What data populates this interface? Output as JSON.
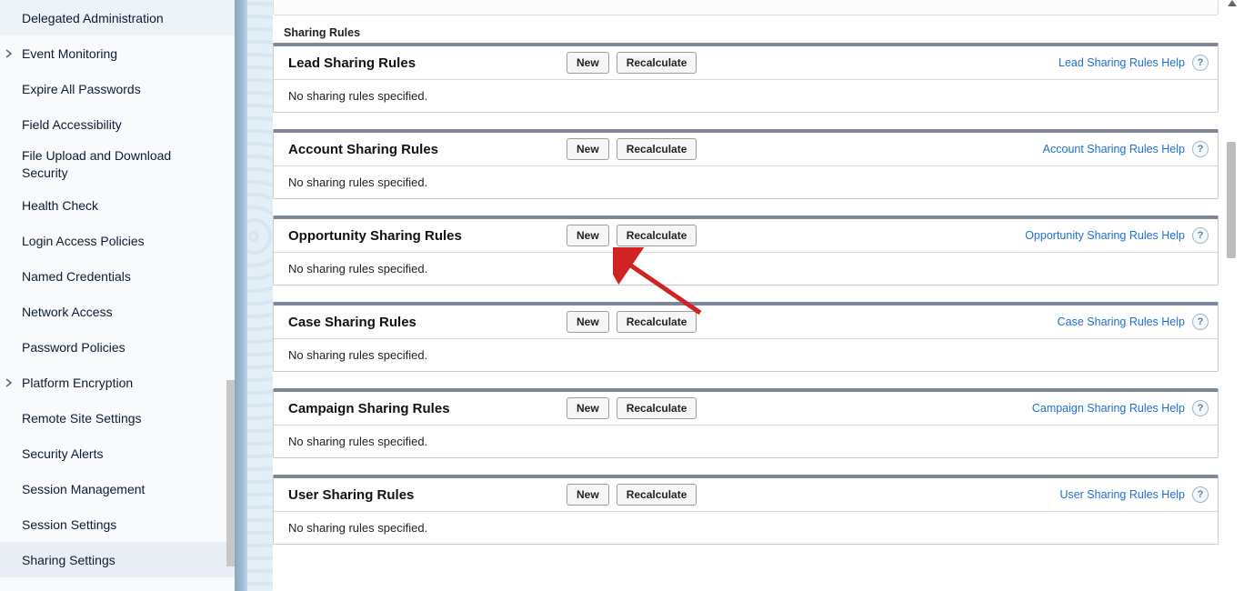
{
  "sidebar": {
    "items": [
      {
        "label": "Delegated Administration",
        "expandable": false
      },
      {
        "label": "Event Monitoring",
        "expandable": true
      },
      {
        "label": "Expire All Passwords",
        "expandable": false
      },
      {
        "label": "Field Accessibility",
        "expandable": false
      },
      {
        "label": "File Upload and Download Security",
        "expandable": false
      },
      {
        "label": "Health Check",
        "expandable": false
      },
      {
        "label": "Login Access Policies",
        "expandable": false
      },
      {
        "label": "Named Credentials",
        "expandable": false
      },
      {
        "label": "Network Access",
        "expandable": false
      },
      {
        "label": "Password Policies",
        "expandable": false
      },
      {
        "label": "Platform Encryption",
        "expandable": true
      },
      {
        "label": "Remote Site Settings",
        "expandable": false
      },
      {
        "label": "Security Alerts",
        "expandable": false
      },
      {
        "label": "Session Management",
        "expandable": false
      },
      {
        "label": "Session Settings",
        "expandable": false
      },
      {
        "label": "Sharing Settings",
        "expandable": false,
        "active": true
      }
    ]
  },
  "main": {
    "section_heading": "Sharing Rules",
    "new_label": "New",
    "recalc_label": "Recalculate",
    "empty_msg": "No sharing rules specified.",
    "blocks": [
      {
        "title": "Lead Sharing Rules",
        "help": "Lead Sharing Rules Help"
      },
      {
        "title": "Account Sharing Rules",
        "help": "Account Sharing Rules Help"
      },
      {
        "title": "Opportunity Sharing Rules",
        "help": "Opportunity Sharing Rules Help"
      },
      {
        "title": "Case Sharing Rules",
        "help": "Case Sharing Rules Help"
      },
      {
        "title": "Campaign Sharing Rules",
        "help": "Campaign Sharing Rules Help"
      },
      {
        "title": "User Sharing Rules",
        "help": "User Sharing Rules Help"
      }
    ]
  }
}
